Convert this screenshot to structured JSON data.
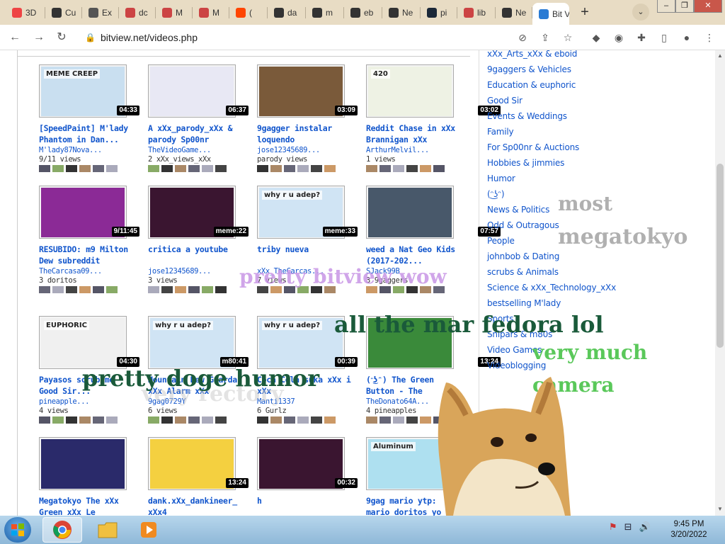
{
  "browser": {
    "tabs": [
      {
        "label": "3D",
        "icon": "3d-icon",
        "color": "#e44"
      },
      {
        "label": "Cu",
        "icon": "cursor-icon",
        "color": "#333"
      },
      {
        "label": "Ex",
        "icon": "puzzle-icon",
        "color": "#555"
      },
      {
        "label": "dc",
        "icon": "wiki-icon",
        "color": "#c44"
      },
      {
        "label": "M",
        "icon": "wiki-icon",
        "color": "#c44"
      },
      {
        "label": "M",
        "icon": "wiki-icon",
        "color": "#c44"
      },
      {
        "label": "(",
        "icon": "reddit-icon",
        "color": "#ff4500"
      },
      {
        "label": "da",
        "icon": "bag-icon",
        "color": "#333"
      },
      {
        "label": "m",
        "icon": "bag-icon",
        "color": "#333"
      },
      {
        "label": "eb",
        "icon": "bag-icon",
        "color": "#333"
      },
      {
        "label": "Ne",
        "icon": "github-icon",
        "color": "#333"
      },
      {
        "label": "pi",
        "icon": "steam-icon",
        "color": "#1b2838"
      },
      {
        "label": "lib",
        "icon": "wiki-icon",
        "color": "#c44"
      },
      {
        "label": "Ne",
        "icon": "github-icon",
        "color": "#333"
      },
      {
        "label": "Bit View",
        "icon": "bitview-icon",
        "color": "#2a7bd4",
        "active": true
      }
    ],
    "url": "bitview.net/videos.php",
    "new_tab": "+",
    "tab_search": "⌄",
    "window_controls": {
      "minimize": "–",
      "maximize": "❐",
      "close": "✕"
    }
  },
  "videos": [
    {
      "title": "[SpeedPaint] M'lady Phantom in Dan...",
      "author": "M'lady87Nova...",
      "views": "9/11 views",
      "duration": "04:33",
      "thumb": "#c9dff0",
      "badge_label": "MEME CREEP"
    },
    {
      "title": "A xXx_parody_xXx & parody Sp00nr",
      "author": "TheVideoGame...",
      "views": "2 xXx_views_xXx",
      "duration": "06:37",
      "thumb": "#e8e8f4"
    },
    {
      "title": "9gagger instalar loquendo",
      "author": "jose12345689...",
      "views": "parody views",
      "duration": "03:09",
      "thumb": "#7a5a3a"
    },
    {
      "title": "Reddit Chase in xXx Brannigan xXx",
      "author": "ArthurMelvil...",
      "views": "1 views",
      "duration": "03:02",
      "thumb": "#eef2e4",
      "badge_label": "420"
    },
    {
      "title": "RESUBIDO: m9 Milton Dew subreddit",
      "author": "TheCarcasa09...",
      "views": "3 doritos",
      "duration": "9/11:45",
      "thumb": "#8b2a96"
    },
    {
      "title": "critica a youtube",
      "author": "jose12345689...",
      "views": "3 views",
      "duration": "meme:22",
      "thumb": "#3a1530"
    },
    {
      "title": "triby nueva",
      "author": "xXx_TheCarcas...",
      "views": "7 views",
      "duration": "meme:33",
      "thumb": "#d0e4f4",
      "badge_label": "why r u adep?"
    },
    {
      "title": "weed a Nat Geo Kids (2017-202...",
      "author": "SJack99B",
      "views": "3 9gaggers",
      "duration": "07:57",
      "thumb": "#48586a"
    },
    {
      "title": "Payasos scrub me Good Sir...",
      "author": "pineapple...",
      "views": "4 views",
      "duration": "04:30",
      "thumb": "#f0f0f0",
      "badge_label": "EUPHORIC"
    },
    {
      "title": "Mountain Dew Guardar xXx Alarm xXx",
      "author": "9gag0729Y",
      "views": "6 views",
      "duration": "m80:41",
      "thumb": "#d0e4f4",
      "badge_label": "why r u adep?"
    },
    {
      "title": "Coca Cola suka xXx i xXx",
      "author": "Manti1337",
      "views": "6 Gurlz",
      "duration": "00:39",
      "thumb": "#d0e4f4",
      "badge_label": "why r u adep?"
    },
    {
      "title": "(ᵔ͜ʖᵔ) The Green Button - The",
      "author": "TheDonato64A...",
      "views": "4 pineapples",
      "duration": "13:24",
      "thumb": "#3a8a3a"
    },
    {
      "title": "Megatokyo The xXx Green xXx Le",
      "author": "",
      "views": "",
      "duration": "",
      "thumb": "#2a2a6a"
    },
    {
      "title": "dank.xXx_dankineer_ xXx4",
      "author": "",
      "views": "",
      "duration": "13:24",
      "thumb": "#f4d040"
    },
    {
      "title": "h",
      "author": "",
      "views": "",
      "duration": "00:32",
      "thumb": "#3a1530"
    },
    {
      "title": "9gag mario ytp: mario doritos yo",
      "author": "",
      "views": "",
      "duration": "triby:15",
      "thumb": "#aee0f0",
      "badge_label": "Aluminum"
    }
  ],
  "categories": [
    "xXx_Arts_xXx & eboid",
    "9gaggers & Vehicles",
    "Education & euphoric",
    "Good Sir",
    "Events & Weddings",
    "Family",
    "For Sp00nr & Auctions",
    "Hobbies & jimmies",
    "Humor",
    "(ᵔ͜ʖᵔ)",
    "News & Politics",
    "Odd & Outragous",
    "People",
    "johnbob & Dating",
    "scrubs & Animals",
    "Science & xXx_Technology_xXx",
    "bestselling M'lady",
    "Sports",
    "Snipars & m80s",
    "Video Games",
    "Videoblogging"
  ],
  "overlays": [
    {
      "text": "most",
      "color": "#b0b0b0"
    },
    {
      "text": "megatokyo",
      "color": "#b0b0b0"
    },
    {
      "text": "pretty bitview wow",
      "color": "#c896e6"
    },
    {
      "text": "all the mar fedora lol",
      "color": "#1a5a3a"
    },
    {
      "text": "very much",
      "color": "#5ac85a"
    },
    {
      "text": "camera",
      "color": "#5ac85a"
    },
    {
      "text": "pretty doge humor",
      "color": "#1a5a3a"
    },
    {
      "text": "very rectory",
      "color": "#c8c8c8"
    }
  ],
  "taskbar": {
    "clock_time": "9:45 PM",
    "clock_date": "3/20/2022"
  }
}
